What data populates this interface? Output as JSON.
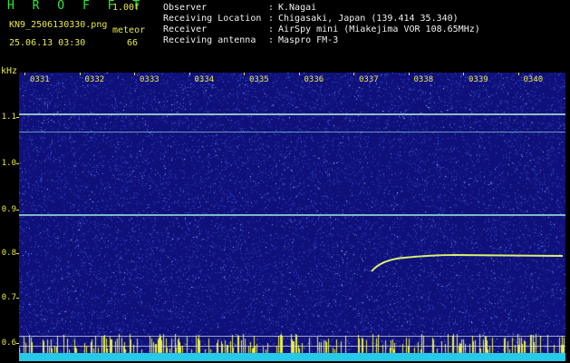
{
  "header": {
    "brand": "H R O F F T",
    "version": "1.00f",
    "filename": "KN9_2506130330.png",
    "datetime": "25.06.13 03:30",
    "mode_label": "meteor",
    "mode_value": "66",
    "info": [
      {
        "key": "Observer",
        "value": "K.Nagai"
      },
      {
        "key": "Receiving Location",
        "value": "Chigasaki, Japan (139.414 35.340)"
      },
      {
        "key": "Receiver",
        "value": "AirSpy mini (Miakejima VOR 108.65MHz)"
      },
      {
        "key": "Receiving antenna",
        "value": "Maspro FM-3"
      }
    ]
  },
  "spectrogram": {
    "y_unit": "kHz",
    "y_ticks": [
      "1.1",
      "1.0",
      "0.9",
      "0.8",
      "0.7",
      "0.6"
    ],
    "x_ticks": [
      "0331",
      "0332",
      "0333",
      "0334",
      "0335",
      "0336",
      "0337",
      "0338",
      "0339",
      "0340"
    ],
    "colors": {
      "background": "#10107a",
      "carrier": "#9ff0d8",
      "meteor": "#d8f070",
      "axis": "#e8e84a"
    }
  }
}
